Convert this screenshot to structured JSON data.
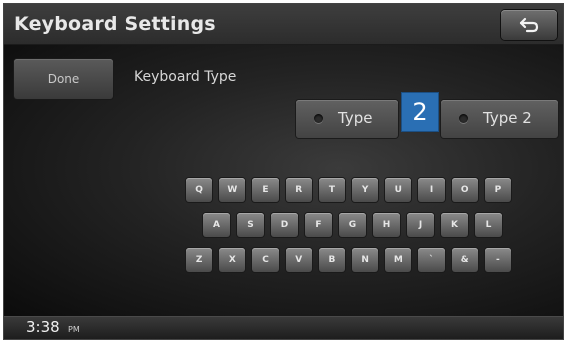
{
  "header": {
    "title": "Keyboard Settings",
    "back_icon": "back-arrow-icon"
  },
  "settings": {
    "done_label": "Done",
    "keyboard_type_label": "Keyboard Type",
    "type_options": [
      {
        "label": "Type"
      },
      {
        "label": "Type 2"
      }
    ],
    "callout": "2"
  },
  "keyboard": {
    "rows": [
      [
        "Q",
        "W",
        "E",
        "R",
        "T",
        "Y",
        "U",
        "I",
        "O",
        "P"
      ],
      [
        "A",
        "S",
        "D",
        "F",
        "G",
        "H",
        "J",
        "K",
        "L"
      ],
      [
        "Z",
        "X",
        "C",
        "V",
        "B",
        "N",
        "M",
        "`",
        "&",
        "-"
      ]
    ]
  },
  "status": {
    "time": "3:38",
    "ampm": "PM"
  }
}
